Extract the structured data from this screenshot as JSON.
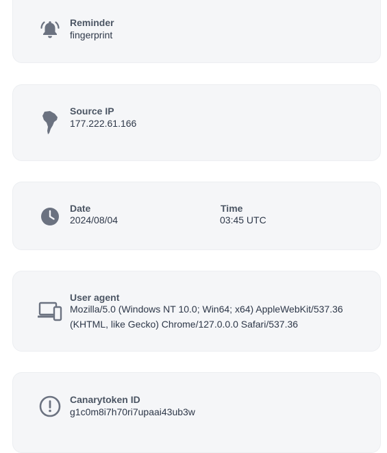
{
  "reminder": {
    "label": "Reminder",
    "value": "fingerprint",
    "icon": "bell-icon"
  },
  "source_ip": {
    "label": "Source IP",
    "value": "177.222.61.166",
    "icon": "south-america-map-icon"
  },
  "datetime": {
    "icon": "clock-icon",
    "date_label": "Date",
    "date_value": "2024/08/04",
    "time_label": "Time",
    "time_value": "03:45 UTC"
  },
  "user_agent": {
    "label": "User agent",
    "value_line1": "Mozilla/5.0 (Windows NT 10.0; Win64; x64) AppleWebKit/537.36",
    "value_line2": "(KHTML, like Gecko) Chrome/127.0.0.0 Safari/537.36",
    "icon": "devices-icon"
  },
  "canarytoken": {
    "label": "Canarytoken ID",
    "value": "g1c0m8i7h70ri7upaai43ub3w",
    "icon": "alert-circle-icon"
  },
  "colors": {
    "card_bg": "#f5f6f8",
    "icon": "#6b7280",
    "label": "#4b5563",
    "value": "#2d3748"
  }
}
